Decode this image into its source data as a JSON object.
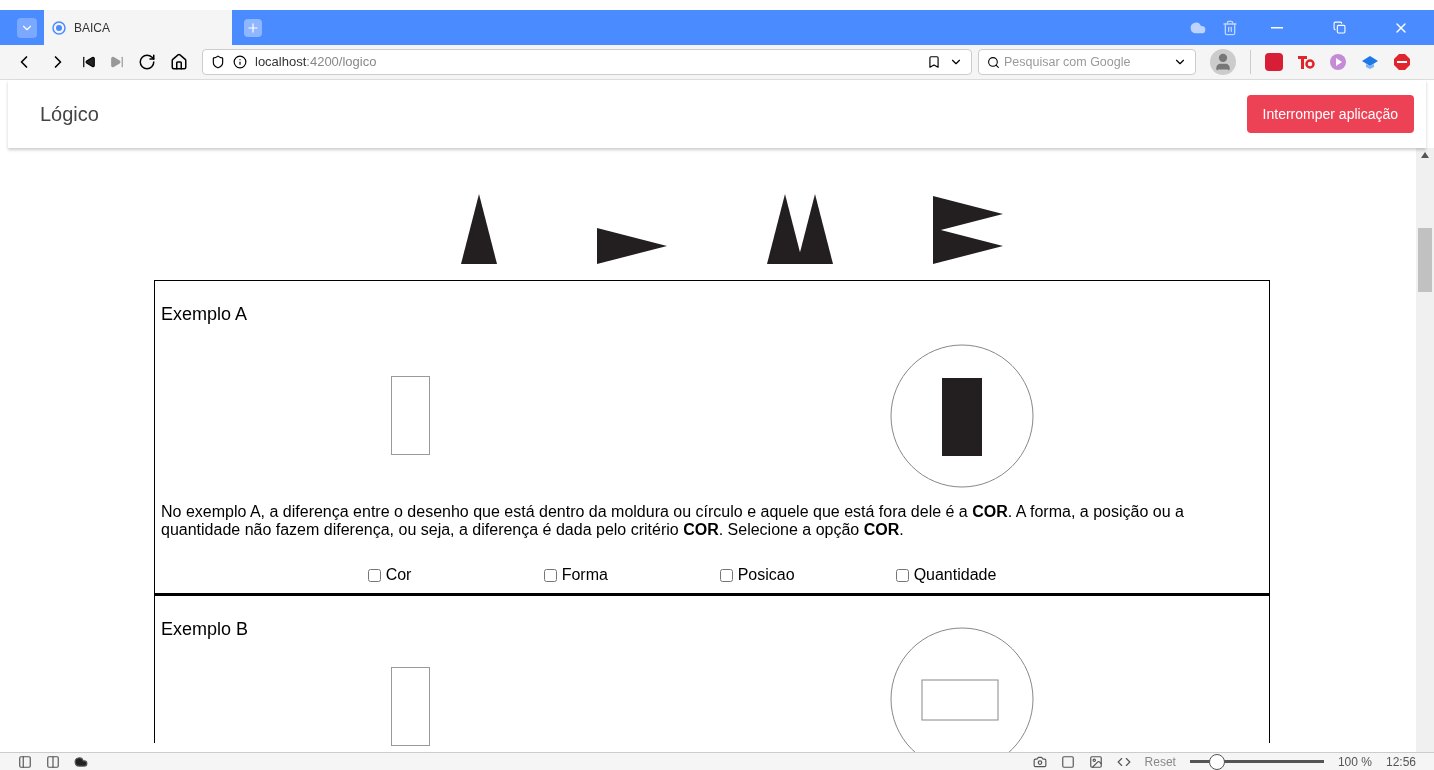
{
  "browser": {
    "tab_title": "BAICA",
    "url_host": "localhost",
    "url_path": ":4200/logico",
    "search_placeholder": "Pesquisar com Google",
    "zoom_reset": "Reset",
    "zoom_level": {
      "level": 0.2
    },
    "zoom_reading": "100 %",
    "clock": "12:56"
  },
  "app": {
    "title": "Lógico",
    "stop_button": "Interromper aplicação"
  },
  "examples": [
    {
      "title": "Exemplo A",
      "text": "No exemplo A, a diferença entre o desenho que está dentro da moldura ou círculo e aquele que está fora dele é a **COR**. A forma, a posição ou a quantidade não fazem diferença, ou seja, a diferença é dada pelo critério **COR**. Selecione a opção **COR**.",
      "options": [
        {
          "label": "Cor",
          "checked": false
        },
        {
          "label": "Forma",
          "checked": false
        },
        {
          "label": "Posicao",
          "checked": false
        },
        {
          "label": "Quantidade",
          "checked": false
        }
      ]
    },
    {
      "title": "Exemplo B"
    }
  ]
}
